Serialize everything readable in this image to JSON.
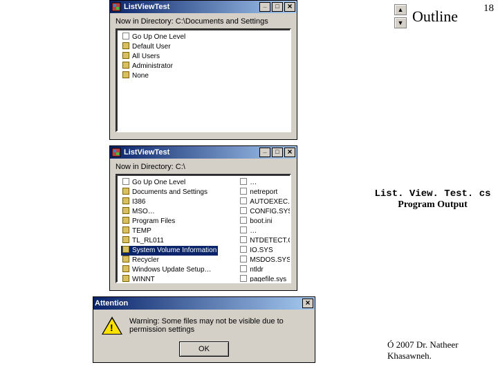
{
  "slide": {
    "outline_label": "Outline",
    "page_number": "18",
    "nav_up": "▲",
    "nav_down": "▼"
  },
  "caption": {
    "file": "List. View. Test. cs",
    "sub": "Program Output"
  },
  "copyright": "Ó 2007 Dr. Natheer Khasawneh.",
  "win1": {
    "title": "ListViewTest",
    "dir_label": "Now in Directory:   C:\\Documents and Settings",
    "items": [
      "Go Up One Level",
      "Default User",
      "All Users",
      "Administrator",
      "None"
    ]
  },
  "win2": {
    "title": "ListViewTest",
    "dir_label": "Now in Directory:    C:\\",
    "col1": [
      "Go Up One Level",
      "Documents and Settings",
      "I386",
      "MSO…",
      "Program Files",
      "TEMP",
      "TL_RL011",
      "System Volume Information",
      "Recycler",
      "Windows Update Setup…",
      "WINNT"
    ],
    "sel_index": 7,
    "col2": [
      "…",
      "netreport",
      "AUTOEXEC.BAT",
      "CONFIG.SYS",
      "boot.ini",
      "…",
      "NTDETECT.COM",
      "IO.SYS",
      "MSDOS.SYS",
      "ntldr",
      "pagefile.sys"
    ]
  },
  "msg": {
    "title": "Attention",
    "text": "Warning: Some files may not be visible due to permission settings",
    "ok": "OK"
  }
}
